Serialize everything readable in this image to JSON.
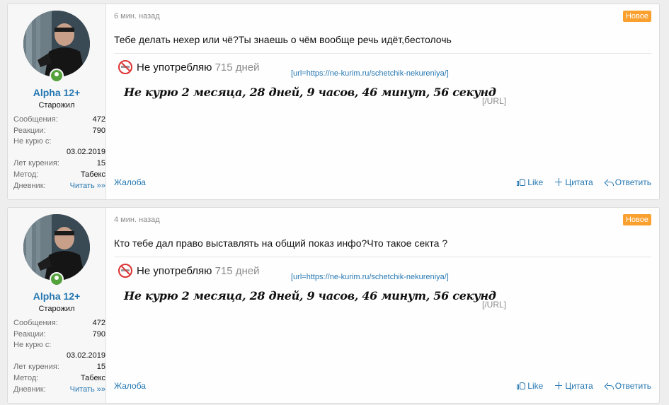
{
  "posts": [
    {
      "user": {
        "name": "Alpha 12+",
        "title": "Старожил",
        "messages_label": "Сообщения:",
        "messages": "472",
        "reactions_label": "Реакции:",
        "reactions": "790",
        "nosmoke_label": "Не курю с:",
        "nosmoke_date": "03.02.2019",
        "years_label": "Лет курения:",
        "years": "15",
        "method_label": "Метод:",
        "method": "Табекс",
        "diary_label": "Дневник:",
        "diary": "Читать »»"
      },
      "time": "6 мин. назад",
      "badge": "Новое",
      "message": "Тебе делать нехер или чё?Ты знаешь о чём вообще речь идёт,бестолочь",
      "signature": {
        "text": "Не употребляю",
        "days": "715 дней",
        "url": "[url=https://ne-kurim.ru/schetchik-nekureniya/]",
        "counter": "Не курю  2 месяца, 28 дней, 9 часов, 46 минут, 56 секунд",
        "close": "[/URL]"
      },
      "report": "Жалоба",
      "like": "Like",
      "quote": "Цитата",
      "reply": "Ответить"
    },
    {
      "user": {
        "name": "Alpha 12+",
        "title": "Старожил",
        "messages_label": "Сообщения:",
        "messages": "472",
        "reactions_label": "Реакции:",
        "reactions": "790",
        "nosmoke_label": "Не курю с:",
        "nosmoke_date": "03.02.2019",
        "years_label": "Лет курения:",
        "years": "15",
        "method_label": "Метод:",
        "method": "Табекс",
        "diary_label": "Дневник:",
        "diary": "Читать »»"
      },
      "time": "4 мин. назад",
      "badge": "Новое",
      "message": "Кто тебе дал право выставлять на общий показ инфо?Что такое секта ?",
      "signature": {
        "text": "Не употребляю",
        "days": "715 дней",
        "url": "[url=https://ne-kurim.ru/schetchik-nekureniya/]",
        "counter": "Не курю  2 месяца, 28 дней, 9 часов, 46 минут, 56 секунд",
        "close": "[/URL]"
      },
      "report": "Жалоба",
      "like": "Like",
      "quote": "Цитата",
      "reply": "Ответить"
    }
  ],
  "colors": {
    "link": "#2577b1",
    "badge": "#f9a02f",
    "online": "#55a13c"
  }
}
